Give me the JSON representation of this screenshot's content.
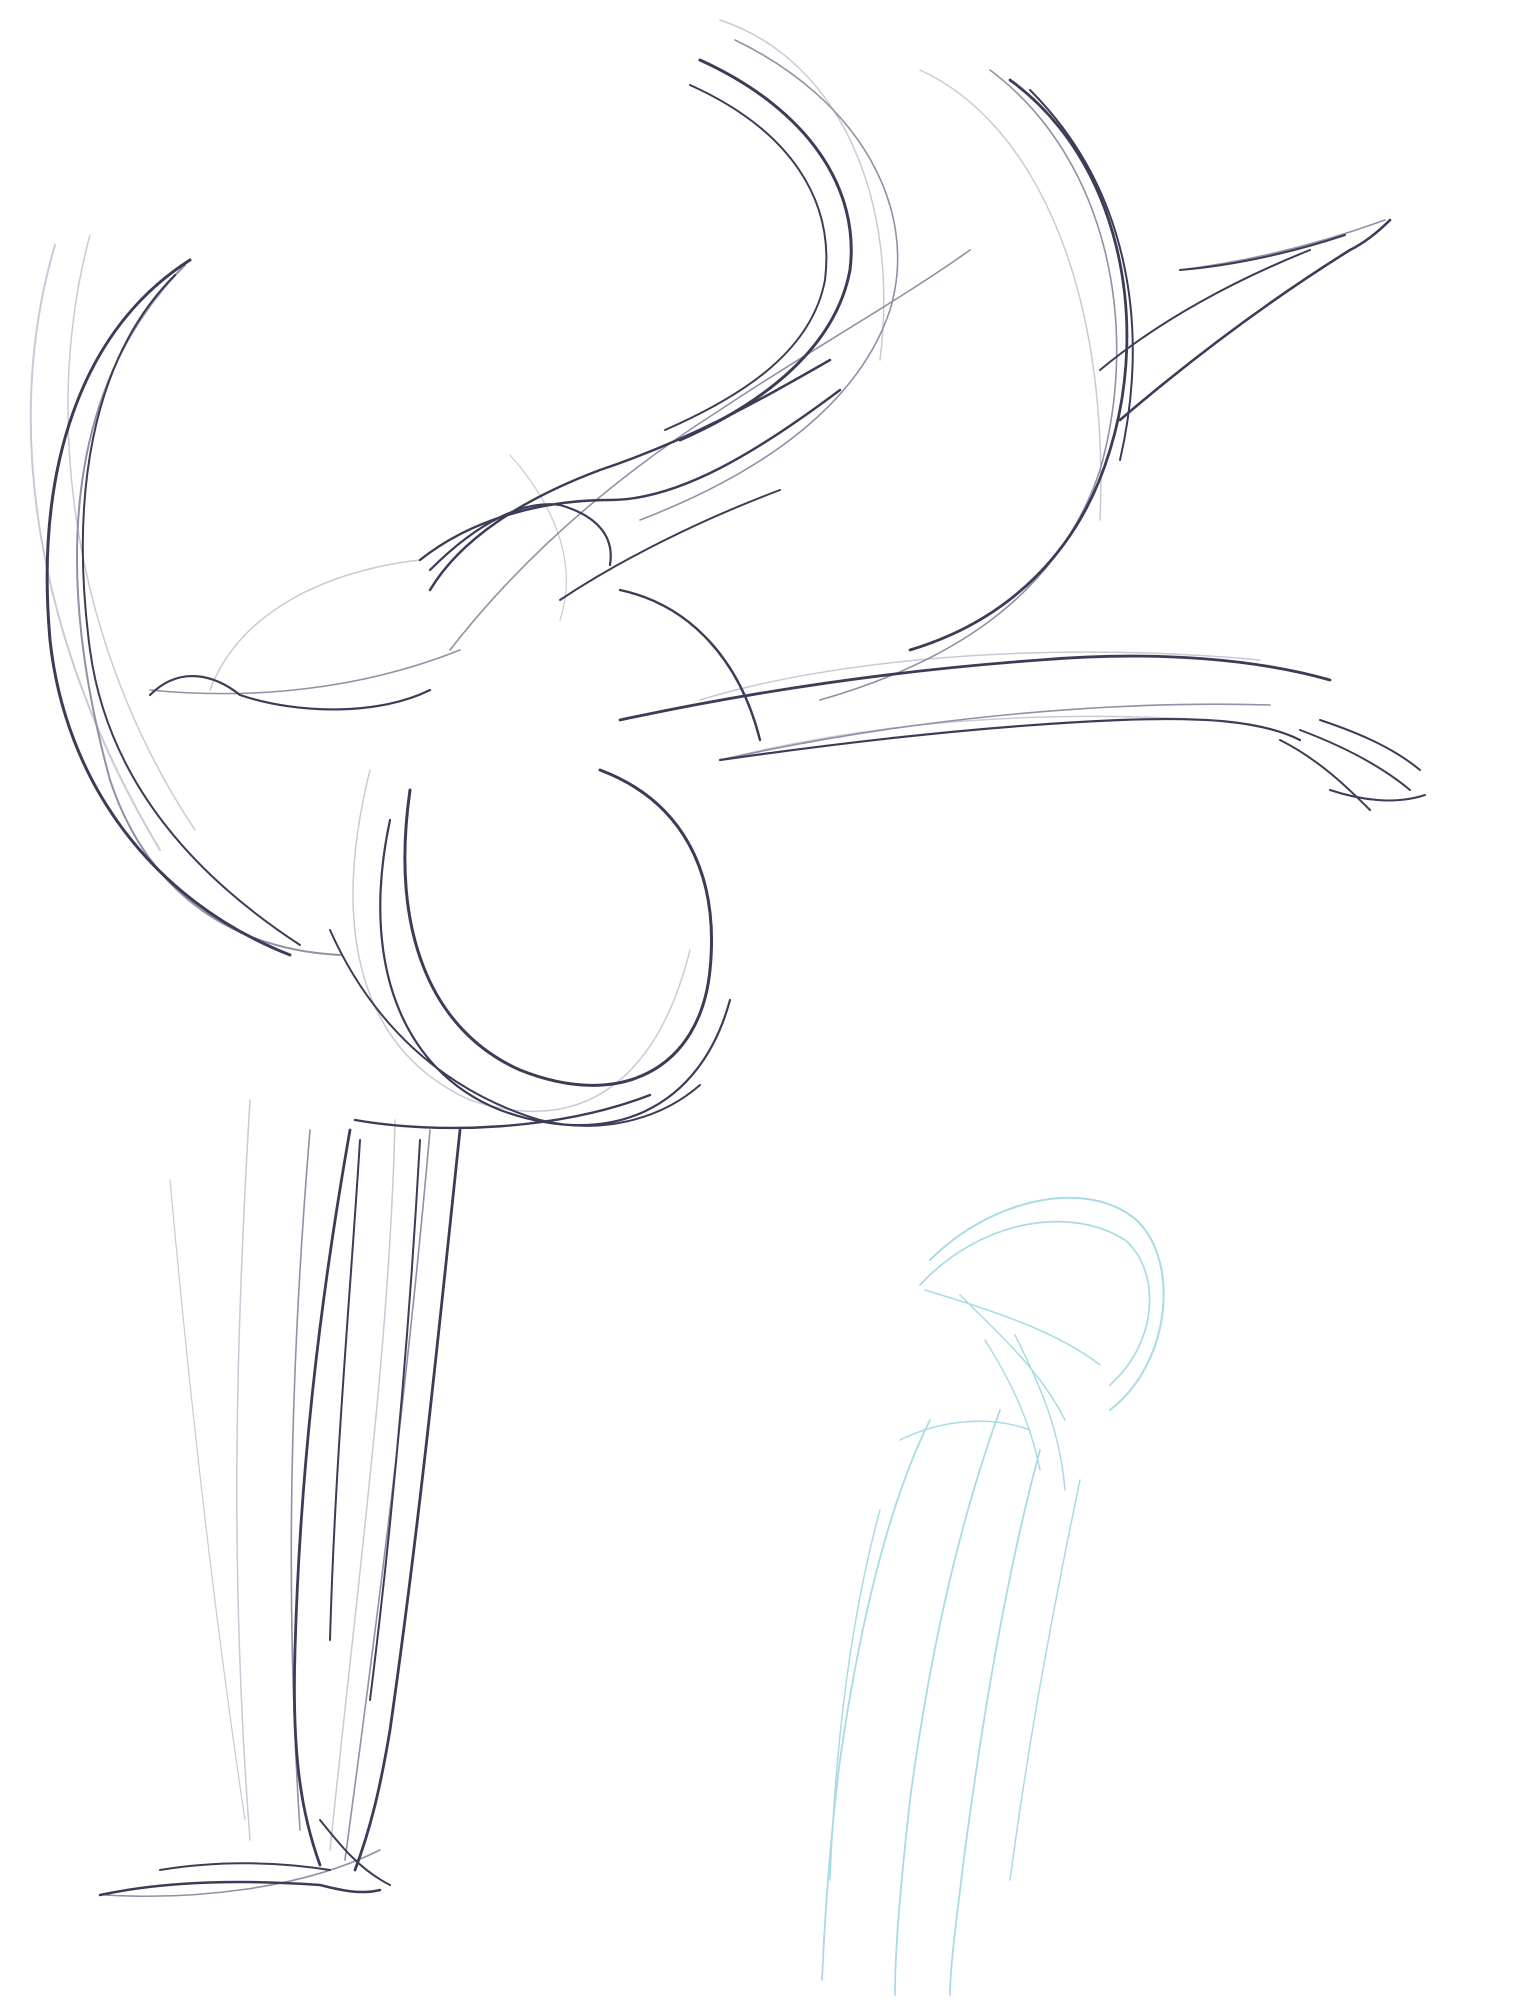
{
  "canvas": {
    "background": "#ffffff",
    "ink_colors": {
      "dark": "#3b3d58",
      "mid": "#8f91a6",
      "light": "#c8cad6",
      "cyan": "#a9dbe6"
    }
  },
  "drawing": {
    "primary_figure": "gesture-figure-sketch",
    "secondary_figure": "cyan-figure-sketch"
  }
}
